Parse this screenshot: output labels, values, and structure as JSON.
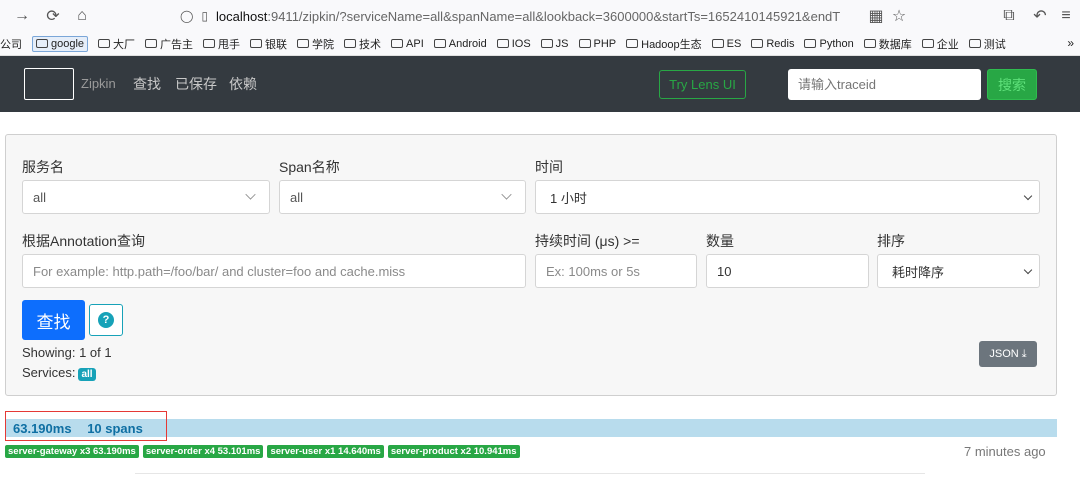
{
  "browser": {
    "url_host": "localhost",
    "url_path": ":9411/zipkin/?serviceName=all&spanName=all&lookback=3600000&startTs=1652410145921&endT",
    "bookmarks": [
      "公司",
      "google",
      "大厂",
      "广告主",
      "甩手",
      "银联",
      "学院",
      "技术",
      "API",
      "Android",
      "IOS",
      "JS",
      "PHP",
      "Hadoop生态",
      "ES",
      "Redis",
      "Python",
      "数据库",
      "企业",
      "测试"
    ]
  },
  "nav": {
    "brand": "Zipkin",
    "links": [
      "查找",
      "已保存",
      "依赖"
    ],
    "lens_label": "Try Lens UI",
    "traceid_placeholder": "请输入traceid",
    "search_label": "搜索"
  },
  "form": {
    "service_label": "服务名",
    "service_value": "all",
    "span_label": "Span名称",
    "span_value": "all",
    "time_label": "时间",
    "time_value": "1 小时",
    "annotation_label": "根据Annotation查询",
    "annotation_placeholder": "For example: http.path=/foo/bar/ and cluster=foo and cache.miss",
    "duration_label": "持续时间 (μs) >=",
    "duration_placeholder": "Ex: 100ms or 5s",
    "limit_label": "数量",
    "limit_value": "10",
    "sort_label": "排序",
    "sort_value": "耗时降序",
    "find_label": "查找",
    "help_label": "?",
    "showing_text": "Showing: 1 of 1",
    "services_label": "Services:",
    "services_badge": "all",
    "json_label": "JSON"
  },
  "results": {
    "duration": "63.190ms",
    "spans": "10 spans",
    "tags": [
      "server-gateway x3 63.190ms",
      "server-order x4 53.101ms",
      "server-user x1 14.640ms",
      "server-product x2 10.941ms"
    ],
    "time_ago": "7 minutes ago"
  },
  "colors": {
    "navbar": "#343a40",
    "primary": "#0d6efd",
    "success": "#28a745",
    "info": "#17a2b8",
    "trace_bar": "#b8dced",
    "highlight": "#e53935"
  }
}
